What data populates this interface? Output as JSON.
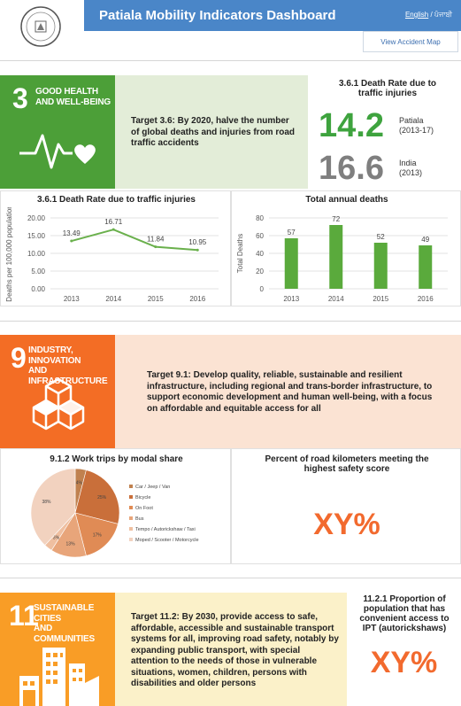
{
  "header": {
    "title": "Patiala Mobility Indicators Dashboard",
    "lang_english": "English",
    "lang_sep": "/",
    "lang_punjabi": "ਪੰਜਾਬੀ",
    "map_button": "View Accident Map"
  },
  "sdg3": {
    "number": "3",
    "name_line1": "GOOD HEALTH",
    "name_line2": "AND WELL-BEING",
    "color": "#4c9f38",
    "target": "Target 3.6: By 2020, halve the number of global deaths and injuries from road traffic accidents",
    "indicator_title": "3.6.1 Death Rate due to traffic injuries",
    "patiala_value": "14.2",
    "patiala_label": "Patiala",
    "patiala_period": "(2013-17)",
    "india_value": "16.6",
    "india_label": "India",
    "india_period": "(2013)"
  },
  "sdg9": {
    "number": "9",
    "name_line1": "INDUSTRY, INNOVATION",
    "name_line2": "AND INFRASTRUCTURE",
    "color": "#f36d25",
    "target": "Target 9.1: Develop quality, reliable, sustainable and resilient infrastructure, including regional and trans-border infrastructure, to support economic development and human well-being, with a focus on affordable and equitable access for all",
    "road_title": "Percent of road kilometers meeting the highest safety score",
    "road_value": "XY%"
  },
  "sdg11": {
    "number": "11",
    "name_line1": "SUSTAINABLE CITIES",
    "name_line2": "AND COMMUNITIES",
    "color": "#f99d26",
    "target": "Target 11.2: By 2030, provide access to safe, affordable, accessible and sustainable transport systems for all, improving road safety, notably by expanding public transport, with special attention to the needs of those in vulnerable situations, women, children, persons with disabilities and older persons",
    "ipt_title": "11.2.1 Proportion of population that has convenient access to IPT (autorickshaws)",
    "ipt_value": "XY%"
  },
  "chart_data": [
    {
      "type": "line",
      "title": "3.6.1 Death Rate due to traffic injuries",
      "ylabel": "Deaths per 100,000 population",
      "xlabel": "",
      "categories": [
        "2013",
        "2014",
        "2015",
        "2016"
      ],
      "values": [
        13.49,
        16.71,
        11.84,
        10.95
      ],
      "data_labels": [
        "13.49",
        "16.71",
        "11.84",
        "10.95"
      ],
      "yticks": [
        "0.00",
        "5.00",
        "10.00",
        "15.00",
        "20.00"
      ],
      "ylim": [
        0,
        20
      ],
      "grid": true,
      "color": "#6ab04c"
    },
    {
      "type": "bar",
      "title": "Total annual deaths",
      "ylabel": "Total Deaths",
      "xlabel": "",
      "categories": [
        "2013",
        "2014",
        "2015",
        "2016"
      ],
      "values": [
        57,
        72,
        52,
        49
      ],
      "yticks": [
        "0",
        "20",
        "40",
        "60",
        "80"
      ],
      "ylim": [
        0,
        80
      ],
      "grid": true,
      "color": "#5aaa3c"
    },
    {
      "type": "pie",
      "title": "9.1.2 Work trips by modal share",
      "slices": [
        {
          "label": "Car / Jeep / Van",
          "value": 4,
          "text": "4%",
          "color": "#c0814f"
        },
        {
          "label": "Bicycle",
          "value": 25,
          "text": "25%",
          "color": "#c96f3a"
        },
        {
          "label": "On Foot",
          "value": 17,
          "text": "17%",
          "color": "#e08b55"
        },
        {
          "label": "Bus",
          "value": 13,
          "text": "13%",
          "color": "#e8a57a"
        },
        {
          "label": "Tempo / Autorickshaw / Taxi",
          "value": 3,
          "text": "3%",
          "color": "#efbfa0"
        },
        {
          "label": "Moped / Scooter / Motorcycle",
          "value": 38,
          "text": "38%",
          "color": "#f2d2bf"
        }
      ],
      "legend": "right"
    }
  ]
}
